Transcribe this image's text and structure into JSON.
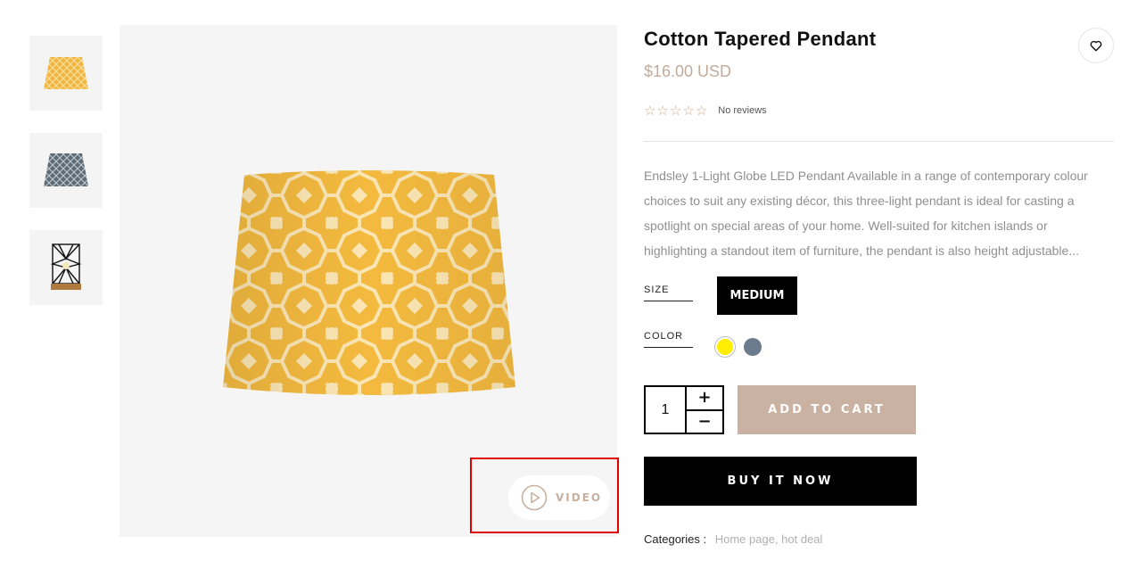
{
  "product": {
    "title": "Cotton Tapered Pendant",
    "price": "$16.00 USD",
    "rating_stars": 0,
    "reviews_text": "No reviews",
    "description": "Endsley 1-Light Globe LED Pendant Available in a range of contemporary colour choices to suit any existing décor, this three-light pendant is ideal for casting a spotlight on special areas of your home. Well-suited for kitchen islands or highlighting a standout item of furniture, the pendant is also height adjustable..."
  },
  "gallery": {
    "thumbnails": [
      "yellow-lampshade",
      "grey-lampshade",
      "wire-cage-lamp"
    ],
    "video_label": "VIDEO"
  },
  "options": {
    "size_label": "SIZE",
    "size_selected": "MEDIUM",
    "color_label": "COLOR",
    "colors": [
      "#ffee00",
      "#6c7b8b"
    ]
  },
  "actions": {
    "quantity": "1",
    "plus": "+",
    "minus": "−",
    "add_to_cart": "ADD TO CART",
    "buy_now": "BUY IT NOW"
  },
  "meta": {
    "categories_label": "Categories :",
    "categories": "Home page, hot deal"
  },
  "colors": {
    "accent": "#c9b2a1",
    "price": "#c2ab9a",
    "highlight_box": "#e00000"
  }
}
